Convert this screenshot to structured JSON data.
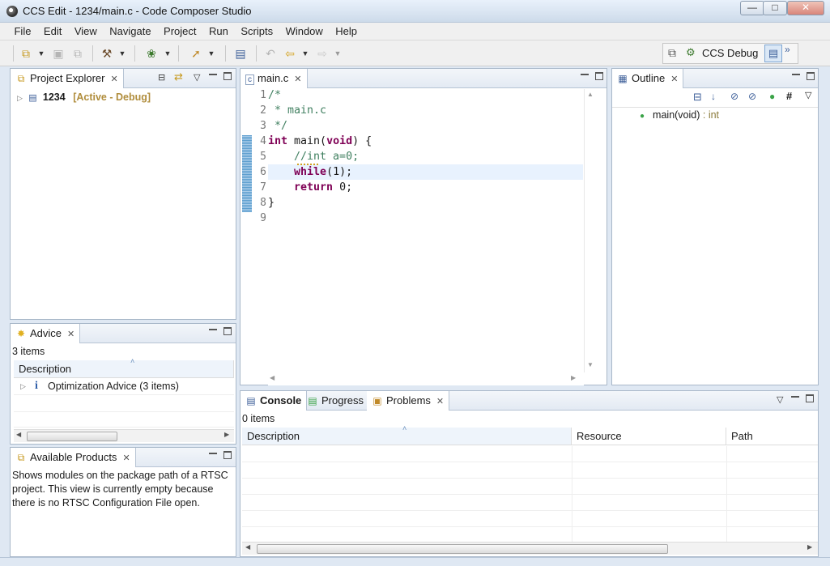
{
  "window": {
    "title": "CCS Edit - 1234/main.c - Code Composer Studio",
    "controls": {
      "minimize": "—",
      "maximize": "□",
      "close": "✕"
    }
  },
  "menu": [
    "File",
    "Edit",
    "View",
    "Navigate",
    "Project",
    "Run",
    "Scripts",
    "Window",
    "Help"
  ],
  "toolbar": {
    "perspective_label": "CCS Debug",
    "icons": [
      "new-icon",
      "save-icon",
      "save-all-icon",
      "build-hammer-icon",
      "debug-bug-icon",
      "flash-icon",
      "terminal-icon",
      "back-nav-icon",
      "prev-edit-icon",
      "next-edit-icon"
    ]
  },
  "project_explorer": {
    "tab_label": "Project Explorer",
    "project_name": "1234",
    "project_status": "[Active - Debug]"
  },
  "advice": {
    "tab_label": "Advice",
    "count": "3 items",
    "column": "Description",
    "rows": [
      "Optimization Advice (3 items)"
    ]
  },
  "available_products": {
    "tab_label": "Available Products",
    "text": "Shows modules on the package path of a RTSC project. This view is currently empty because there is no RTSC Configuration File open."
  },
  "editor": {
    "tab_label": "main.c",
    "line_numbers": [
      "1",
      "2",
      "3",
      "4",
      "5",
      "6",
      "7",
      "8",
      "9"
    ],
    "code": {
      "l1": "/*",
      "l2": " * main.c",
      "l3": " */",
      "l4_kw1": "int",
      "l4_rest": " main(",
      "l4_kw2": "void",
      "l4_end": ") {",
      "l5_comment": "    //int a=0;",
      "l6_kw": "while",
      "l6_rest": "(1);",
      "l7_kw": "return",
      "l7_rest": " 0;",
      "l8": "}"
    }
  },
  "outline": {
    "tab_label": "Outline",
    "item_name": "main(void)",
    "item_type": " : int"
  },
  "bottom": {
    "tabs": {
      "console": "Console",
      "progress": "Progress",
      "problems": "Problems"
    },
    "count": "0 items",
    "columns": {
      "description": "Description",
      "resource": "Resource",
      "path": "Path"
    }
  },
  "colors": {
    "keyword": "#7f0055",
    "comment": "#3f7f5f",
    "active_project": "#b08d3c",
    "current_line": "#e8f2fe",
    "change_marker": "#5e9fcf"
  }
}
